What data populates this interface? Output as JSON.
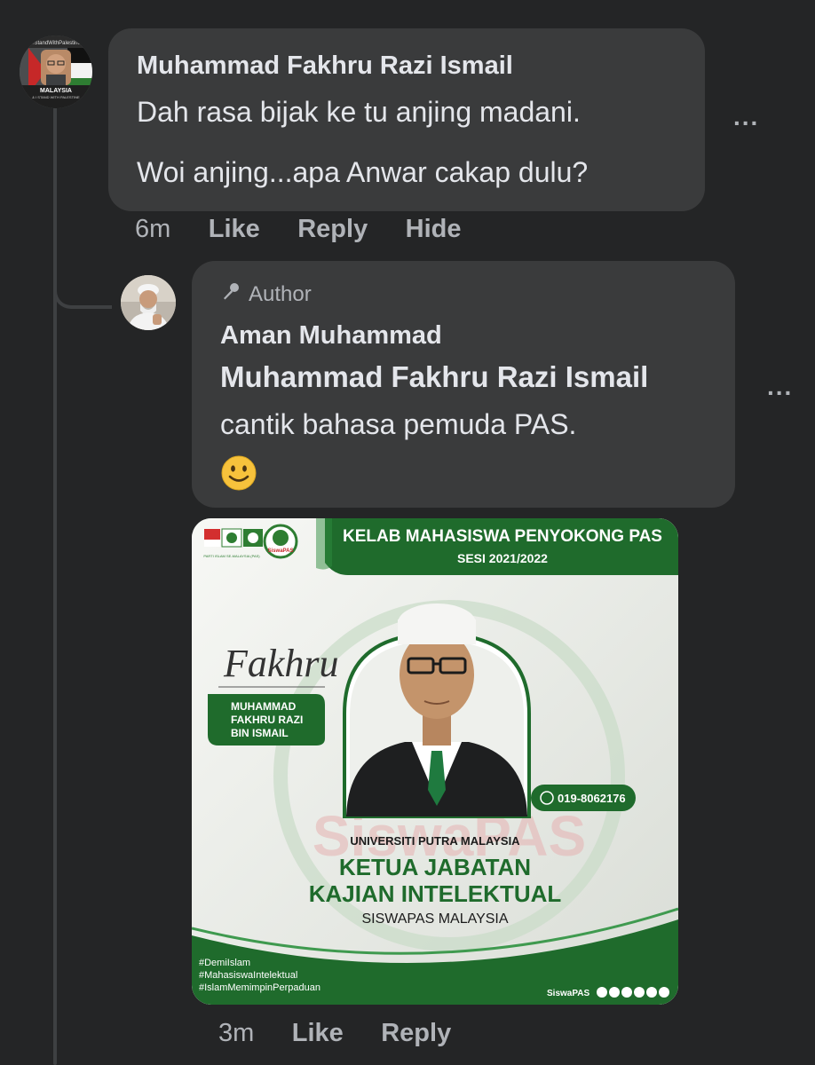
{
  "comment1": {
    "avatar": {
      "header_text": "#StandWithPalestine",
      "country": "MALAYSIA",
      "caption": "& I STAND WITH PALESTINE"
    },
    "name": "Muhammad Fakhru Razi Ismail",
    "line1": "Dah rasa bijak ke tu anjing madani.",
    "line2": "Woi anjing...apa Anwar cakap dulu?",
    "more": "...",
    "actions": {
      "time": "6m",
      "like": "Like",
      "reply": "Reply",
      "hide": "Hide"
    }
  },
  "reply": {
    "badge": "Author",
    "name": "Aman Muhammad",
    "mention": "Muhammad Fakhru Razi Ismail",
    "text": "cantik bahasa pemuda PAS.",
    "more": "...",
    "poster": {
      "header_title": "KELAB MAHASISWA PENYOKONG PAS",
      "header_session": "SESI 2021/2022",
      "signature": "Fakhru",
      "name_lines": [
        "MUHAMMAD",
        "FAKHRU RAZI",
        "BIN ISMAIL"
      ],
      "phone": "019-8062176",
      "university": "UNIVERSITI PUTRA MALAYSIA",
      "position_line1": "KETUA JABATAN",
      "position_line2": "KAJIAN INTELEKTUAL",
      "org": "SISWAPAS MALAYSIA",
      "hashtags": [
        "#DemiIslam",
        "#MahasiswaIntelektual",
        "#IslamMemimpinPerpaduan"
      ],
      "footer_brand": "SiswaPAS",
      "logo_text": "SiswaPAS",
      "watermark": "SiswaPAS",
      "small_logo_text": "PARTI ISLAM SE-MALAYSIA (PAS)"
    },
    "actions": {
      "time": "3m",
      "like": "Like",
      "reply": "Reply"
    }
  },
  "colors": {
    "background": "#242526",
    "bubble": "#3a3b3c",
    "text_primary": "#e4e6eb",
    "text_secondary": "#b0b3b8",
    "poster_green": "#1f6b2c"
  }
}
